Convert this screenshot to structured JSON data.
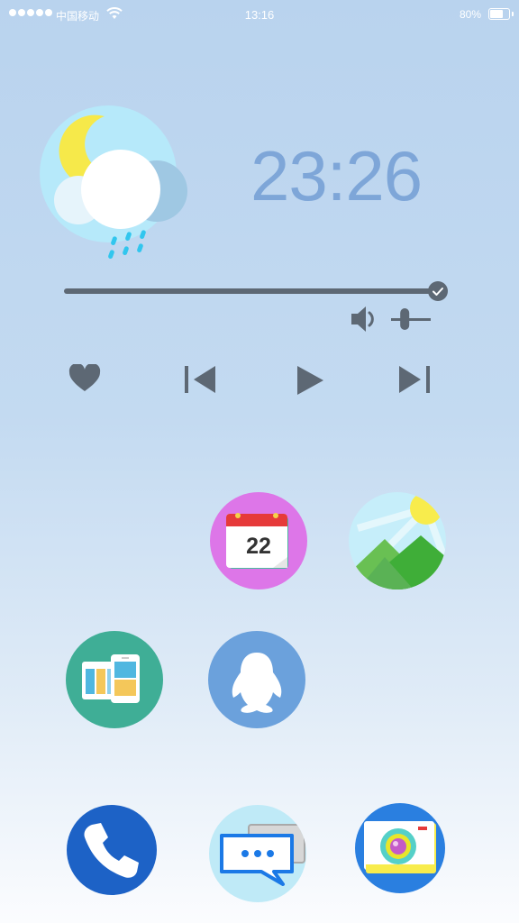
{
  "status_bar": {
    "carrier": "中国移动",
    "time": "13:16",
    "battery_percent": "80%",
    "battery_level": 0.8
  },
  "widget": {
    "time": "23:26",
    "weather_icon": "moon-cloud-rain-icon",
    "seek_progress": 1.0,
    "volume_level": 0.3
  },
  "media_controls": [
    "heart-icon",
    "previous-track-icon",
    "play-icon",
    "next-track-icon"
  ],
  "apps": {
    "calendar_day": "22"
  },
  "colors": {
    "time_text": "#7ea6d8",
    "control_gray": "#5d6874",
    "calendar_bg": "#dd76e8",
    "gallery_bg": "#c6eefa",
    "files_bg": "#3fae96",
    "qq_bg": "#6ba1dc",
    "phone_bg": "#1d62c6",
    "messages_bg": "#bfeaf7",
    "camera_bg": "#2a7fe0"
  }
}
